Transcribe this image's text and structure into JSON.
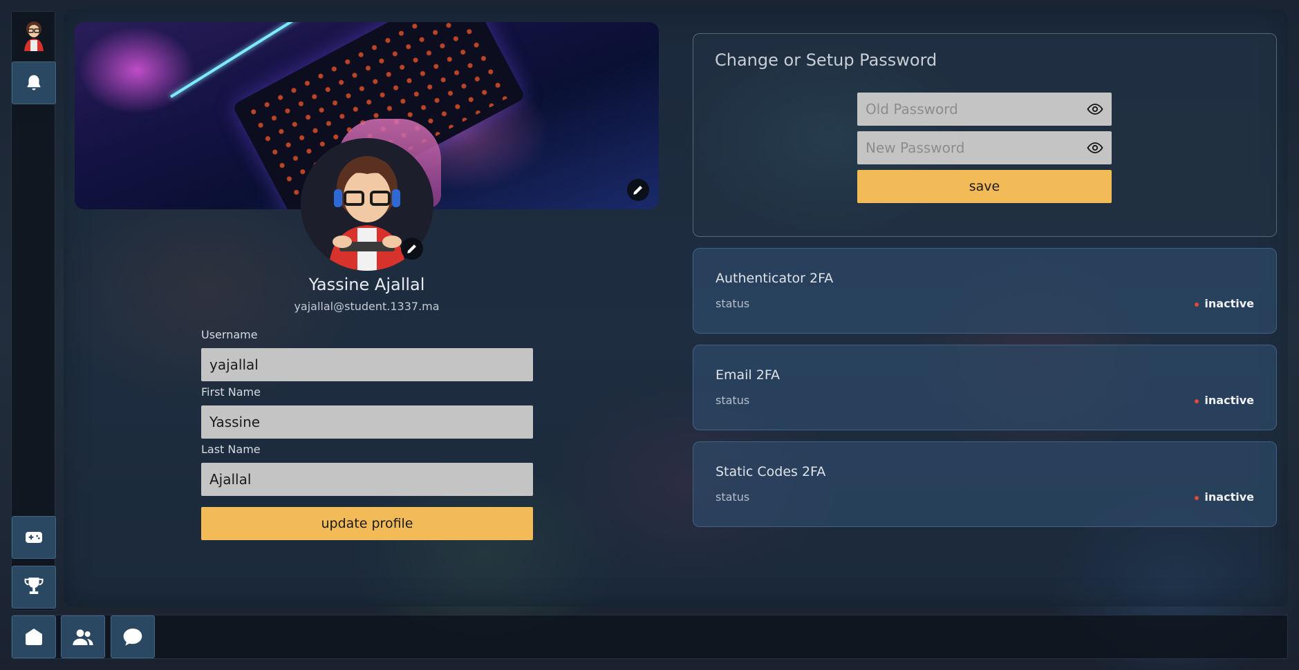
{
  "sidebar": {
    "items": [
      {
        "name": "notifications",
        "icon": "bell-icon"
      },
      {
        "name": "game",
        "icon": "gamepad-icon"
      },
      {
        "name": "leaderboard",
        "icon": "trophy-icon"
      }
    ]
  },
  "bottombar": {
    "items": [
      {
        "name": "home",
        "icon": "home-icon"
      },
      {
        "name": "friends",
        "icon": "users-icon"
      },
      {
        "name": "chat",
        "icon": "chat-bubble-icon"
      }
    ]
  },
  "profile": {
    "name": "Yassine Ajallal",
    "email": "yajallal@student.1337.ma",
    "fields": [
      {
        "label": "Username",
        "value": "yajallal"
      },
      {
        "label": "First Name",
        "value": "Yassine"
      },
      {
        "label": "Last Name",
        "value": "Ajallal"
      }
    ],
    "update_label": "update profile"
  },
  "password": {
    "title": "Change or Setup Password",
    "old_placeholder": "Old Password",
    "new_placeholder": "New Password",
    "save_label": "save"
  },
  "twofa": [
    {
      "title": "Authenticator 2FA",
      "status_label": "status",
      "status": "inactive"
    },
    {
      "title": "Email 2FA",
      "status_label": "status",
      "status": "inactive"
    },
    {
      "title": "Static Codes 2FA",
      "status_label": "status",
      "status": "inactive"
    }
  ],
  "colors": {
    "accent": "#f2bb57",
    "inactive_dot": "#e04a3a",
    "nav_button": "#2b4863"
  }
}
